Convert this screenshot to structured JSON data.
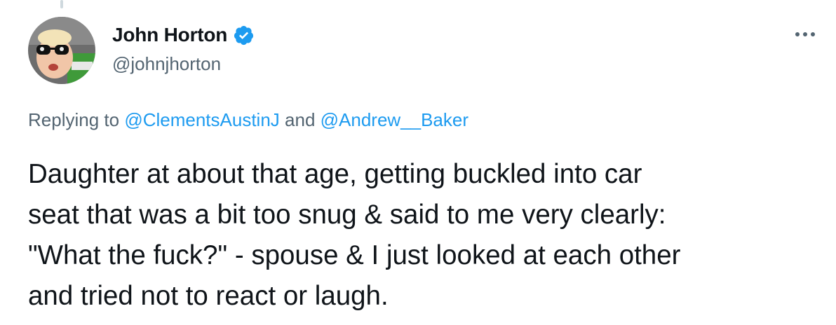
{
  "author": {
    "name": "John Horton",
    "handle": "@johnjhorton",
    "verified": true,
    "avatar_icon": "profile-photo-child-sunglasses"
  },
  "more_icon": "more-options-icon",
  "reply_context": {
    "prefix": "Replying to ",
    "mentions": [
      "@ClementsAustinJ",
      "@Andrew__Baker"
    ],
    "joiner": " and "
  },
  "tweet": {
    "lines": [
      "Daughter at about that age, getting buckled into car",
      "seat that was a bit too snug & said to me very clearly:",
      "\"What the fuck?\" - spouse & I just looked at each other",
      "and tried not to react or laugh."
    ]
  },
  "colors": {
    "text": "#0f1419",
    "secondary": "#536471",
    "accent": "#1d9bf0"
  }
}
